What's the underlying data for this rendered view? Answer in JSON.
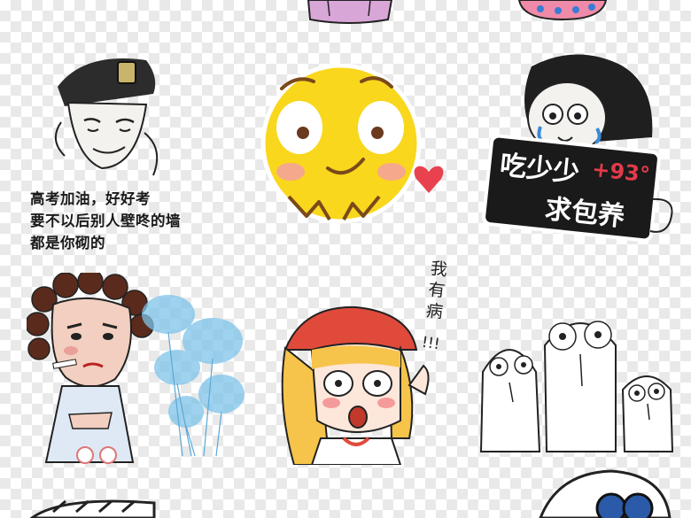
{
  "stickers": {
    "soldier_meme": {
      "caption_lines": [
        "高考加油，好好考",
        "要不以后别人壁咚的墙",
        "都是你砌的"
      ]
    },
    "lion": {
      "sign_line1": "吃少少",
      "sign_number": "+93°",
      "sign_line2": "求包养"
    },
    "girl": {
      "speech_chars": [
        "我",
        "有",
        "病"
      ],
      "exclaim": "!!!"
    }
  },
  "colors": {
    "emoji_yellow": "#f9d71c",
    "blush": "#f5a0a0",
    "heart": "#e8424e",
    "sign_black": "#1a1a1a",
    "beret_red": "#e04a3b",
    "hair_blonde": "#f6c44a",
    "flower_blue": "#7ec4ea"
  }
}
